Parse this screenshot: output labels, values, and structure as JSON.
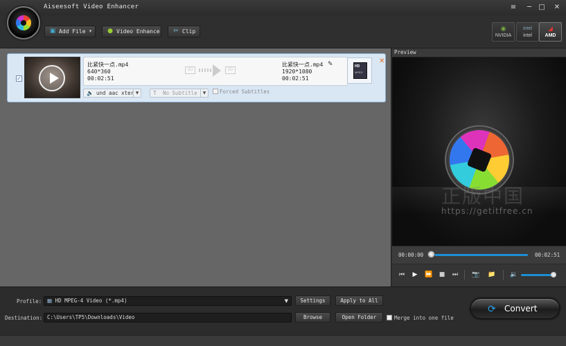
{
  "window": {
    "title": "Aiseesoft Video Enhancer",
    "menu_icon": "menu-icon",
    "min_label": "─",
    "max_label": "□",
    "close_label": "✕"
  },
  "toolbar": {
    "add_file": "Add File",
    "add_file_arrow": "▾",
    "video_enhance": "Video Enhance",
    "clip": "Clip"
  },
  "gpu": [
    {
      "name": "NVIDIA",
      "icon": "nvidia-icon"
    },
    {
      "name": "intel",
      "icon": "intel-icon"
    },
    {
      "name": "AMD",
      "icon": "amd-icon"
    }
  ],
  "file": {
    "checked": "✓",
    "source_name": "比紧快一点.mp4",
    "source_resolution": "640*360",
    "source_duration": "00:02:51",
    "badge_from": "2D",
    "badge_to": "2D",
    "output_name": "比紧快一点.mp4",
    "output_resolution": "1920*1080",
    "output_duration": "00:02:51",
    "output_badge": "HD",
    "output_badge_sub": "MPEG",
    "audio_track": "und aac xter",
    "subtitle": "No Subtitle",
    "forced_subtitles": "Forced Subtitles",
    "close": "✕"
  },
  "preview": {
    "title": "Preview",
    "watermark_cn": "正版中国",
    "watermark_url": "https://getitfree.cn",
    "time_current": "00:00:00",
    "time_total": "00:02:51",
    "progress": 0.0,
    "volume": 0.9
  },
  "bottom": {
    "profile_label": "Profile:",
    "profile_value": "HD MPEG-4 Video (*.mp4)",
    "settings": "Settings",
    "apply_to_all": "Apply to All",
    "destination_label": "Destination:",
    "destination_value": "C:\\Users\\TP5\\Downloads\\Video",
    "browse": "Browse",
    "open_folder": "Open Folder",
    "merge": "Merge into one file",
    "convert": "Convert"
  },
  "colors": {
    "accent": "#1b8fd6",
    "file_row_bg": "#d9e7f5"
  }
}
